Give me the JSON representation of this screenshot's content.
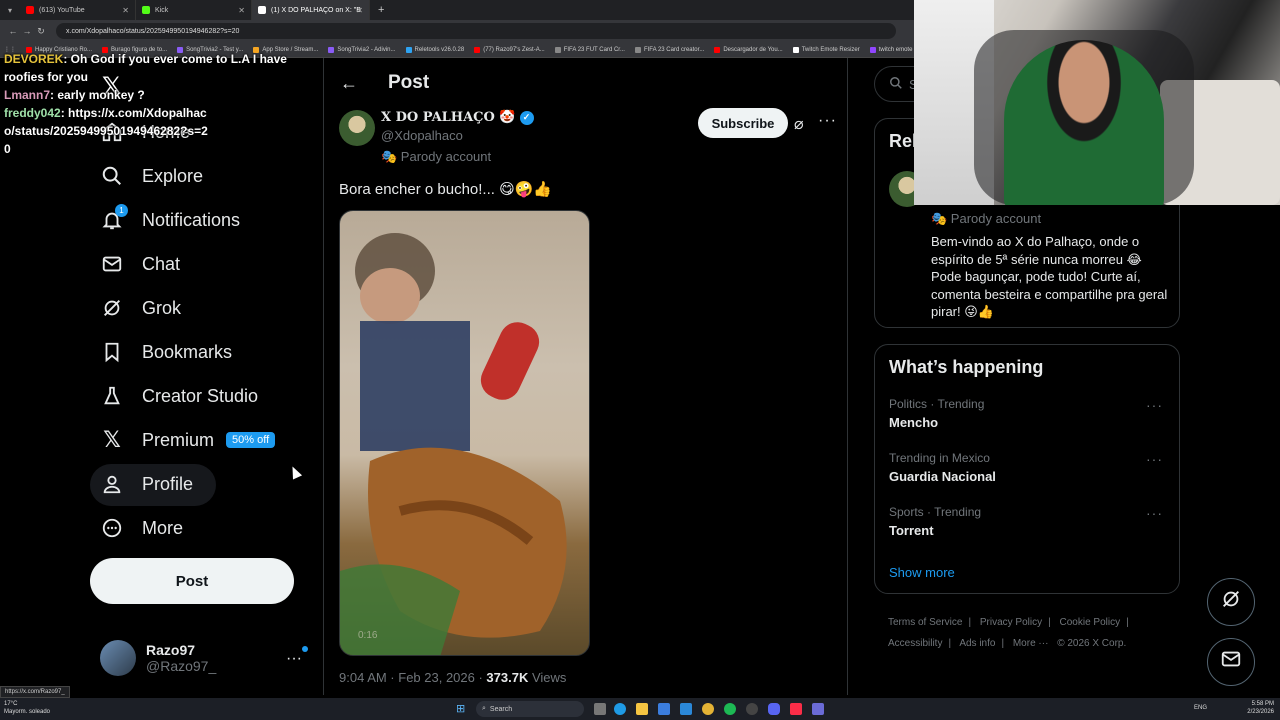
{
  "browser": {
    "tabs": [
      {
        "label": "(613) YouTube",
        "color": "#ff0000"
      },
      {
        "label": "Kick",
        "color": "#53fc18"
      },
      {
        "label": "(1) X DO PALHAÇO on X: \"B",
        "color": "#ffffff"
      }
    ],
    "url": "x.com/Xdopalhaco/status/2025949950194946282?s=20",
    "bookmarks": [
      {
        "label": "Happy Cristiano Ro...",
        "color": "#ff0000"
      },
      {
        "label": "Burago figura de to...",
        "color": "#ff0000"
      },
      {
        "label": "SongTrivia2 - Test y...",
        "color": "#8a5cf5"
      },
      {
        "label": "App Store / Stream...",
        "color": "#f5a623"
      },
      {
        "label": "SongTrivia2 - Adivin...",
        "color": "#8a5cf5"
      },
      {
        "label": "Reletools v26.0.28",
        "color": "#2ea3f2"
      },
      {
        "label": "(77) Razo97's Zest-A...",
        "color": "#ff0000"
      },
      {
        "label": "FIFA 23 FUT Card Cr...",
        "color": "#888888"
      },
      {
        "label": "FIFA 23 Card creator...",
        "color": "#888888"
      },
      {
        "label": "Descargador de You...",
        "color": "#ff0000"
      },
      {
        "label": "Twitch Emote Resizer",
        "color": "#ffffff"
      },
      {
        "label": "twitch emote re",
        "color": "#9146ff"
      }
    ]
  },
  "chat": [
    {
      "user": "DEVOREK",
      "text": ": Oh God if you ever come to L.A I have roofies for you",
      "color": "yellow"
    },
    {
      "user": "Lmann7",
      "text": ": early monkey ?",
      "color": "pink"
    },
    {
      "user": "freddy042",
      "text": ": https://x.com/Xdopalhaco/status/2025949950194946282?s=20",
      "color": "green"
    }
  ],
  "sidebar": {
    "items": [
      {
        "label": "Home",
        "icon": "home-icon"
      },
      {
        "label": "Explore",
        "icon": "search-icon"
      },
      {
        "label": "Notifications",
        "icon": "bell-icon",
        "badge": "1"
      },
      {
        "label": "Chat",
        "icon": "mail-icon"
      },
      {
        "label": "Grok",
        "icon": "grok-icon"
      },
      {
        "label": "Bookmarks",
        "icon": "bookmark-icon"
      },
      {
        "label": "Creator Studio",
        "icon": "creator-icon"
      },
      {
        "label": "Premium",
        "icon": "x-icon",
        "promo": "50% off"
      },
      {
        "label": "Profile",
        "icon": "person-icon"
      },
      {
        "label": "More",
        "icon": "more-circle-icon"
      }
    ],
    "post_label": "Post",
    "account": {
      "name": "Razo97",
      "handle": "@Razo97_"
    }
  },
  "post": {
    "header_title": "Post",
    "author_name": "X DO PALHAÇO 🤡",
    "author_handle": "@Xdopalhaco",
    "parody_label": "🎭 Parody account",
    "subscribe_label": "Subscribe",
    "text": "Bora encher o bucho!... 😋🤪👍",
    "video_time": "0:16",
    "time": "9:04 AM · Feb 23, 2026 · ",
    "views_count": "373.7K",
    "views_label": " Views"
  },
  "right": {
    "search_placeholder": "Se",
    "relevant_title": "Rel",
    "parody_label": "🎭 Parody account",
    "bio": "Bem-vindo ao X do Palhaço, onde o espírito de 5ª série nunca morreu 😂 Pode bagunçar, pode tudo! Curte aí, comenta besteira e compartilhe pra geral pirar! 😜👍",
    "whats_happening_title": "What’s happening",
    "trends": [
      {
        "context": "Politics · Trending",
        "name": "Mencho"
      },
      {
        "context": "Trending in Mexico",
        "name": "Guardia Nacional"
      },
      {
        "context": "Sports · Trending",
        "name": "Torrent"
      }
    ],
    "show_more": "Show more",
    "footer_links": [
      "Terms of Service",
      "|",
      "Privacy Policy",
      "|",
      "Cookie Policy",
      "|",
      "Accessibility",
      "|",
      "Ads info",
      "|",
      "More ···",
      "© 2026 X Corp."
    ]
  },
  "status_bar_url": "https://x.com/Razo97_",
  "taskbar": {
    "weather_temp": "17°C",
    "weather_text": "Mayorm. soleado",
    "search_label": "Search",
    "lang": "ENG",
    "time": "5:58 PM",
    "date": "2/23/2026"
  }
}
